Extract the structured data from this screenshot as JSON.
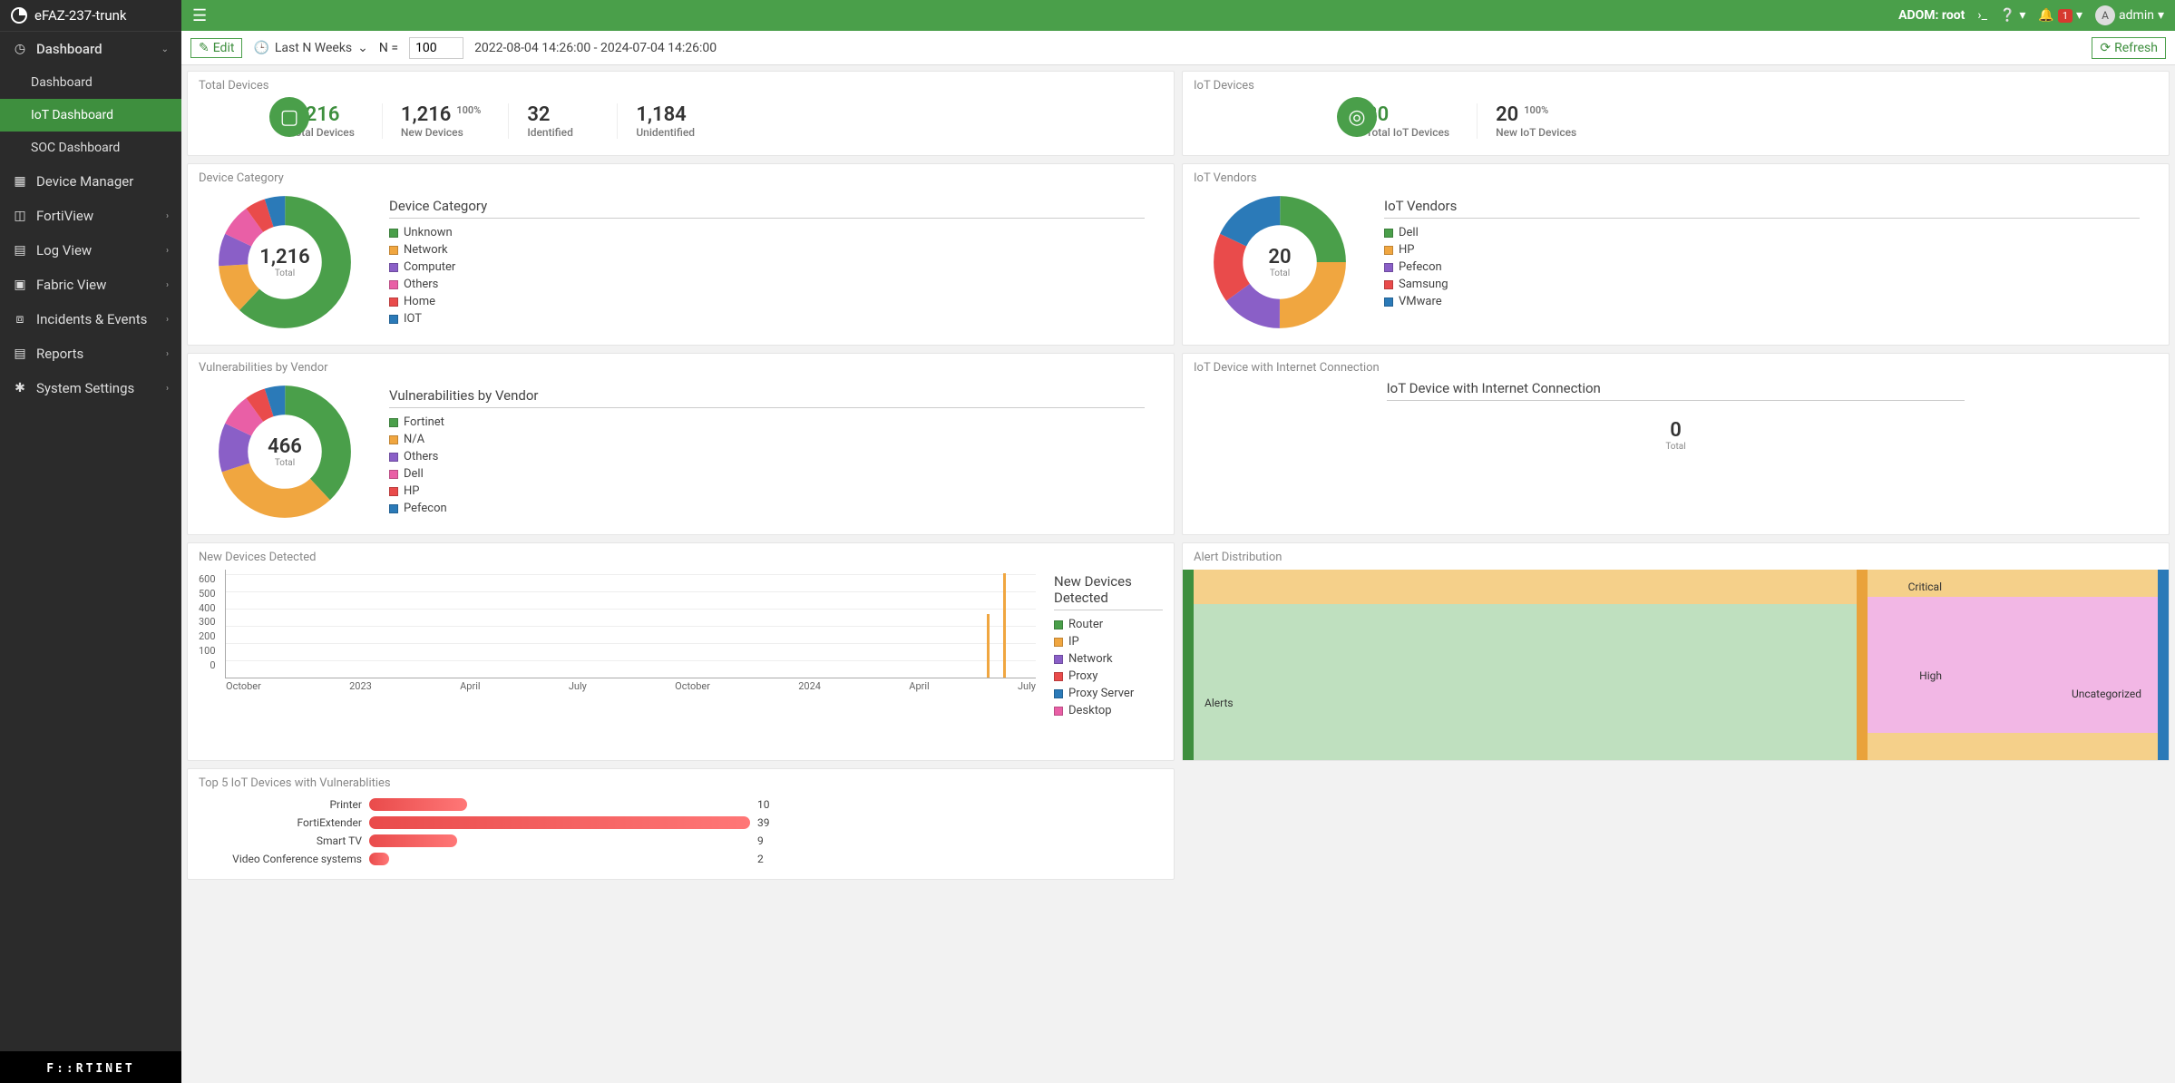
{
  "product_name": "eFAZ-237-trunk",
  "topbar": {
    "adom_label": "ADOM: root",
    "alert_count": "1",
    "user_initial": "A",
    "user_name": "admin"
  },
  "toolbar": {
    "edit_label": "Edit",
    "time_preset": "Last N Weeks",
    "n_label": "N =",
    "n_value": "100",
    "date_range": "2022-08-04 14:26:00 - 2024-07-04 14:26:00",
    "refresh_label": "Refresh"
  },
  "sidebar": {
    "items": [
      {
        "label": "Dashboard",
        "icon": "gauge",
        "expandable": true,
        "open": true,
        "children": [
          {
            "label": "Dashboard"
          },
          {
            "label": "IoT Dashboard",
            "active": true
          },
          {
            "label": "SOC Dashboard"
          }
        ]
      },
      {
        "label": "Device Manager",
        "icon": "grid"
      },
      {
        "label": "FortiView",
        "icon": "cube",
        "expandable": true
      },
      {
        "label": "Log View",
        "icon": "bars",
        "expandable": true
      },
      {
        "label": "Fabric View",
        "icon": "frame",
        "expandable": true
      },
      {
        "label": "Incidents & Events",
        "icon": "alert",
        "expandable": true
      },
      {
        "label": "Reports",
        "icon": "doc",
        "expandable": true
      },
      {
        "label": "System Settings",
        "icon": "gear",
        "expandable": true
      }
    ],
    "footer_brand": "F::RTINET"
  },
  "cards": {
    "total_devices": {
      "title": "Total Devices",
      "stats": [
        {
          "value": "1,216",
          "label": "Total Devices",
          "green": true
        },
        {
          "value": "1,216",
          "label": "New Devices",
          "pct": "100%"
        },
        {
          "value": "32",
          "label": "Identified"
        },
        {
          "value": "1,184",
          "label": "Unidentified"
        }
      ]
    },
    "iot_devices": {
      "title": "IoT Devices",
      "stats": [
        {
          "value": "20",
          "label": "Total IoT Devices",
          "green": true
        },
        {
          "value": "20",
          "label": "New IoT Devices",
          "pct": "100%"
        }
      ]
    },
    "device_category": {
      "title": "Device Category",
      "legend_title": "Device Category",
      "center_value": "1,216",
      "center_label": "Total",
      "items": [
        {
          "label": "Unknown",
          "color": "#4a9f4a",
          "pct": 62
        },
        {
          "label": "Network",
          "color": "#f0a640",
          "pct": 12
        },
        {
          "label": "Computer",
          "color": "#8a5fc7",
          "pct": 8
        },
        {
          "label": "Others",
          "color": "#e95fa6",
          "pct": 8
        },
        {
          "label": "Home",
          "color": "#e94b4b",
          "pct": 5
        },
        {
          "label": "IOT",
          "color": "#2b7ab8",
          "pct": 5
        }
      ]
    },
    "iot_vendors": {
      "title": "IoT Vendors",
      "legend_title": "IoT Vendors",
      "center_value": "20",
      "center_label": "Total",
      "items": [
        {
          "label": "Dell",
          "color": "#4a9f4a",
          "pct": 25
        },
        {
          "label": "HP",
          "color": "#f0a640",
          "pct": 25
        },
        {
          "label": "Pefecon",
          "color": "#8a5fc7",
          "pct": 15
        },
        {
          "label": "Samsung",
          "color": "#e94b4b",
          "pct": 17
        },
        {
          "label": "VMware",
          "color": "#2b7ab8",
          "pct": 18
        }
      ]
    },
    "vuln_vendor": {
      "title": "Vulnerabilities by Vendor",
      "legend_title": "Vulnerabilities by Vendor",
      "center_value": "466",
      "center_label": "Total",
      "items": [
        {
          "label": "Fortinet",
          "color": "#4a9f4a",
          "pct": 38
        },
        {
          "label": "N/A",
          "color": "#f0a640",
          "pct": 32
        },
        {
          "label": "Others",
          "color": "#8a5fc7",
          "pct": 12
        },
        {
          "label": "Dell",
          "color": "#e95fa6",
          "pct": 8
        },
        {
          "label": "HP",
          "color": "#e94b4b",
          "pct": 5
        },
        {
          "label": "Pefecon",
          "color": "#2b7ab8",
          "pct": 5
        }
      ]
    },
    "iot_internet": {
      "title": "IoT Device with Internet Connection",
      "legend_title": "IoT Device with Internet Connection",
      "center_value": "0",
      "center_label": "Total"
    },
    "new_devices_detected": {
      "title": "New Devices Detected",
      "legend_title": "New Devices Detected",
      "y_ticks": [
        "600",
        "500",
        "400",
        "300",
        "200",
        "100",
        "0"
      ],
      "x_ticks": [
        "October",
        "2023",
        "April",
        "July",
        "October",
        "2024",
        "April",
        "July"
      ],
      "items": [
        {
          "label": "Router",
          "color": "#4a9f4a"
        },
        {
          "label": "IP",
          "color": "#f0a640"
        },
        {
          "label": "Network",
          "color": "#8a5fc7"
        },
        {
          "label": "Proxy",
          "color": "#e94b4b"
        },
        {
          "label": "Proxy Server",
          "color": "#2b7ab8"
        },
        {
          "label": "Desktop",
          "color": "#e95fa6"
        }
      ]
    },
    "top5": {
      "title": "Top 5 IoT Devices with Vulnerablities",
      "rows": [
        {
          "label": "Printer",
          "value": 10
        },
        {
          "label": "FortiExtender",
          "value": 39
        },
        {
          "label": "Smart TV",
          "value": 9
        },
        {
          "label": "Video Conference systems",
          "value": 2
        }
      ],
      "max": 39
    },
    "alert_dist": {
      "title": "Alert Distribution",
      "left": "Alerts",
      "levels": [
        "Critical",
        "High",
        "Uncategorized"
      ]
    }
  },
  "chart_data": [
    {
      "type": "pie",
      "title": "Device Category",
      "total": 1216,
      "series": [
        {
          "name": "Unknown",
          "value": 754
        },
        {
          "name": "Network",
          "value": 146
        },
        {
          "name": "Computer",
          "value": 97
        },
        {
          "name": "Others",
          "value": 97
        },
        {
          "name": "Home",
          "value": 61
        },
        {
          "name": "IOT",
          "value": 61
        }
      ]
    },
    {
      "type": "pie",
      "title": "IoT Vendors",
      "total": 20,
      "series": [
        {
          "name": "Dell",
          "value": 5
        },
        {
          "name": "HP",
          "value": 5
        },
        {
          "name": "Pefecon",
          "value": 3
        },
        {
          "name": "Samsung",
          "value": 3
        },
        {
          "name": "VMware",
          "value": 4
        }
      ]
    },
    {
      "type": "pie",
      "title": "Vulnerabilities by Vendor",
      "total": 466,
      "series": [
        {
          "name": "Fortinet",
          "value": 177
        },
        {
          "name": "N/A",
          "value": 149
        },
        {
          "name": "Others",
          "value": 56
        },
        {
          "name": "Dell",
          "value": 37
        },
        {
          "name": "HP",
          "value": 23
        },
        {
          "name": "Pefecon",
          "value": 23
        }
      ]
    },
    {
      "type": "bar",
      "title": "New Devices Detected",
      "ylim": [
        0,
        600
      ],
      "categories": [
        "2022-10",
        "2023-01",
        "2023-04",
        "2023-07",
        "2023-10",
        "2024-01",
        "2024-04",
        "2024-07"
      ],
      "series": [
        {
          "name": "IP",
          "values": [
            0,
            0,
            0,
            0,
            0,
            0,
            0,
            620
          ]
        },
        {
          "name": "Router",
          "values": [
            0,
            0,
            0,
            0,
            0,
            0,
            0,
            40
          ]
        }
      ]
    },
    {
      "type": "bar",
      "title": "Top 5 IoT Devices with Vulnerablities",
      "categories": [
        "Printer",
        "FortiExtender",
        "Smart TV",
        "Video Conference systems"
      ],
      "values": [
        10,
        39,
        9,
        2
      ]
    }
  ]
}
